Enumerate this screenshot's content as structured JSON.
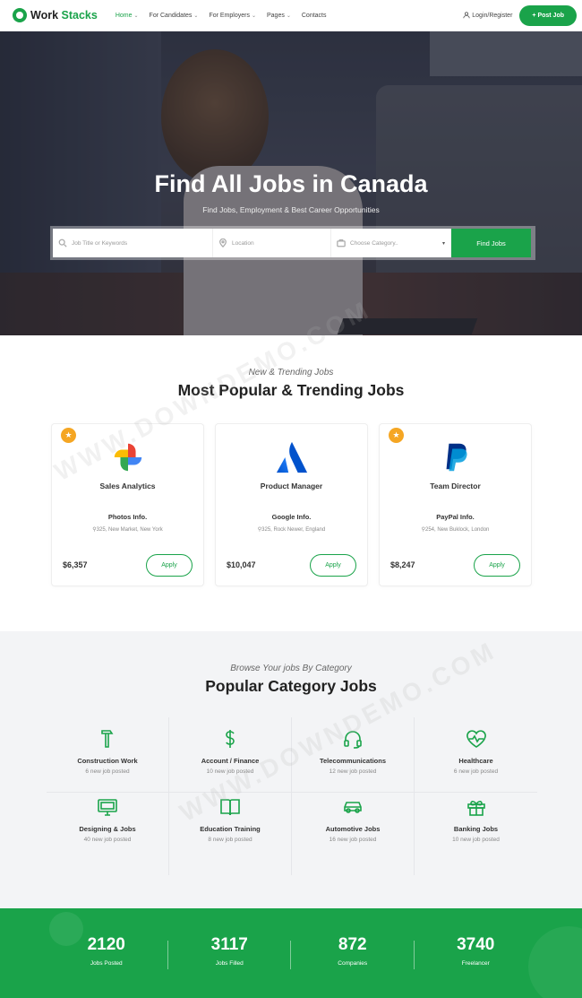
{
  "brand": {
    "name_part1": "Work",
    "name_part2": "Stacks"
  },
  "nav": {
    "items": [
      {
        "label": "Home",
        "active": true
      },
      {
        "label": "For Candidates"
      },
      {
        "label": "For Employers"
      },
      {
        "label": "Pages"
      },
      {
        "label": "Contacts"
      }
    ],
    "login_label": "Login/Register",
    "post_job_label": "+ Post Job"
  },
  "hero": {
    "title": "Find All Jobs in Canada",
    "subtitle": "Find Jobs, Employment & Best Career Opportunities",
    "search": {
      "keyword_placeholder": "Job Title or Keywords",
      "location_placeholder": "Location",
      "category_placeholder": "Choose Category..",
      "button_label": "Find Jobs"
    }
  },
  "trending": {
    "subtitle": "New & Trending Jobs",
    "title": "Most Popular & Trending Jobs",
    "jobs": [
      {
        "title": "Sales Analytics",
        "company": "Photos Info.",
        "location": "325, New Market, New York",
        "salary": "$6,357",
        "apply": "Apply",
        "featured": true
      },
      {
        "title": "Product Manager",
        "company": "Google Info.",
        "location": "325, Rock Newer, England",
        "salary": "$10,047",
        "apply": "Apply",
        "featured": false
      },
      {
        "title": "Team Director",
        "company": "PayPal Info.",
        "location": "254, New Buklock, London",
        "salary": "$8,247",
        "apply": "Apply",
        "featured": true
      }
    ]
  },
  "categories": {
    "subtitle": "Browse Your jobs By Category",
    "title": "Popular Category Jobs",
    "items": [
      {
        "name": "Construction Work",
        "count": "6 new job posted",
        "icon": "hammer-icon"
      },
      {
        "name": "Account / Finance",
        "count": "10 new job posted",
        "icon": "dollar-icon"
      },
      {
        "name": "Telecommunications",
        "count": "12 new job posted",
        "icon": "headset-icon"
      },
      {
        "name": "Healthcare",
        "count": "6 new job posted",
        "icon": "heart-pulse-icon"
      },
      {
        "name": "Designing & Jobs",
        "count": "40 new job posted",
        "icon": "monitor-icon"
      },
      {
        "name": "Education Training",
        "count": "8 new job posted",
        "icon": "book-icon"
      },
      {
        "name": "Automotive Jobs",
        "count": "16 new job posted",
        "icon": "car-icon"
      },
      {
        "name": "Banking Jobs",
        "count": "10 new job posted",
        "icon": "gift-icon"
      }
    ]
  },
  "stats": [
    {
      "value": "2120",
      "label": "Jobs Posted"
    },
    {
      "value": "3117",
      "label": "Jobs Filled"
    },
    {
      "value": "872",
      "label": "Companies"
    },
    {
      "value": "3740",
      "label": "Freelancer"
    }
  ],
  "colors": {
    "accent": "#1aa34a",
    "star": "#f5a623"
  },
  "watermark": "WWW.DOWNDEMO.COM"
}
